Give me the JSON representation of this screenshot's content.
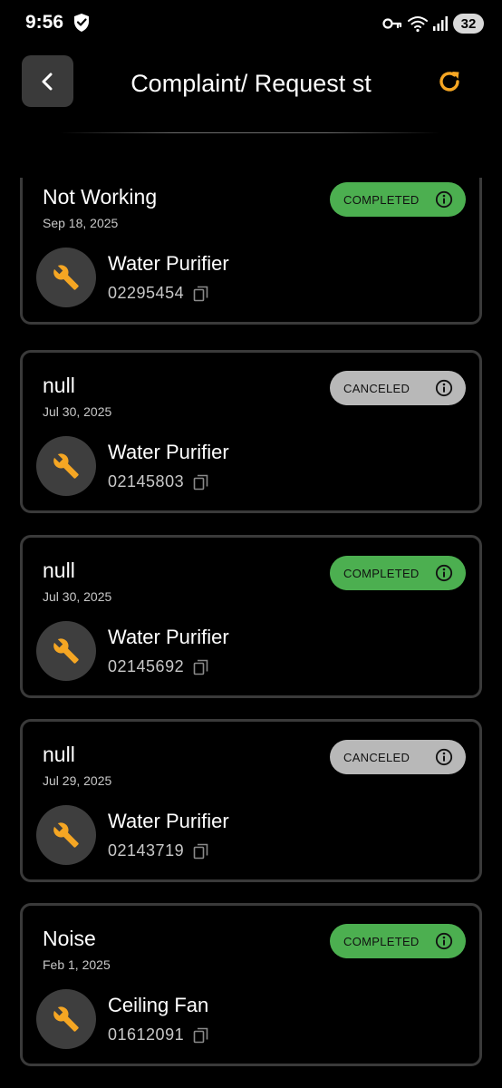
{
  "status_bar": {
    "time": "9:56",
    "battery": "32"
  },
  "header": {
    "title": "Complaint/ Request st"
  },
  "colors": {
    "accent": "#f5a623",
    "completed": "#4caf50",
    "canceled": "#b8b8b8",
    "card_border": "#3a3a3a"
  },
  "icons": {
    "back": "chevron-left-icon",
    "refresh": "refresh-icon",
    "product": "wrench-icon",
    "info": "info-icon",
    "copy": "copy-icon"
  },
  "requests": [
    {
      "title": "Not Working",
      "date": "Sep 18, 2025",
      "status": "COMPLETED",
      "status_type": "completed",
      "product": "Water Purifier",
      "serial": "02295454"
    },
    {
      "title": "null",
      "date": "Jul 30, 2025",
      "status": "CANCELED",
      "status_type": "canceled",
      "product": "Water Purifier",
      "serial": "02145803"
    },
    {
      "title": "null",
      "date": "Jul 30, 2025",
      "status": "COMPLETED",
      "status_type": "completed",
      "product": "Water Purifier",
      "serial": "02145692"
    },
    {
      "title": "null",
      "date": "Jul 29, 2025",
      "status": "CANCELED",
      "status_type": "canceled",
      "product": "Water Purifier",
      "serial": "02143719"
    },
    {
      "title": "Noise",
      "date": "Feb 1, 2025",
      "status": "COMPLETED",
      "status_type": "completed",
      "product": "Ceiling Fan",
      "serial": "01612091"
    }
  ]
}
